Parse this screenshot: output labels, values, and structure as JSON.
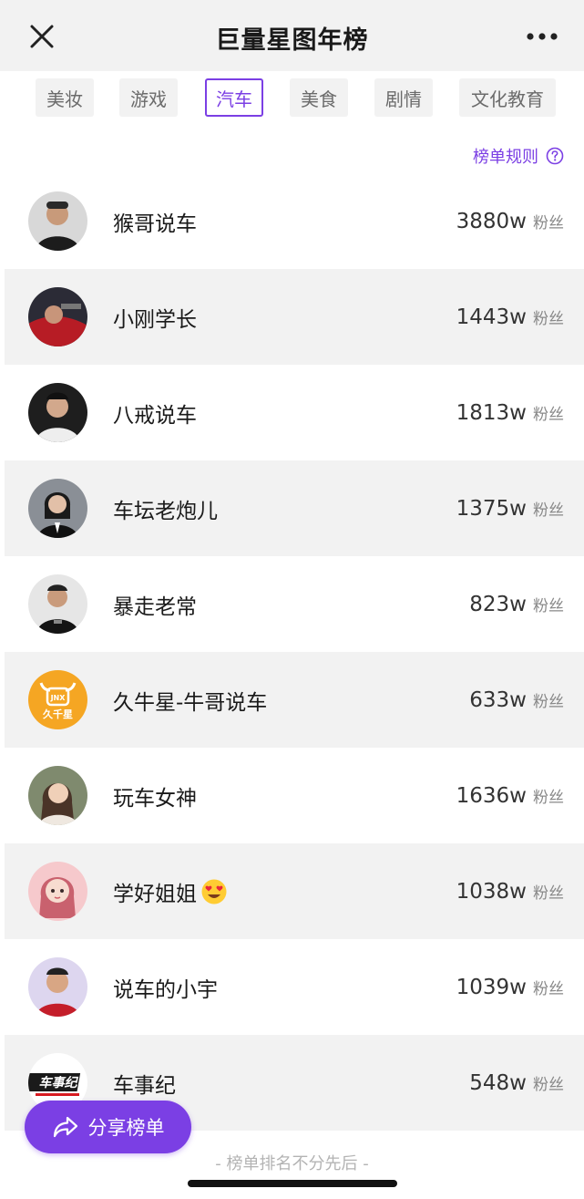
{
  "header": {
    "title": "巨量星图年榜",
    "close_icon": "close-icon",
    "more_icon": "more-icon"
  },
  "tabs": [
    {
      "label": "美妆",
      "active": false
    },
    {
      "label": "游戏",
      "active": false
    },
    {
      "label": "汽车",
      "active": true
    },
    {
      "label": "美食",
      "active": false
    },
    {
      "label": "剧情",
      "active": false
    },
    {
      "label": "文化教育",
      "active": false
    }
  ],
  "rules": {
    "label": "榜单规则",
    "icon": "question-circle-icon"
  },
  "fans_label": "粉丝",
  "items": [
    {
      "name": "猴哥说车",
      "count": "3880w"
    },
    {
      "name": "小刚学长",
      "count": "1443w"
    },
    {
      "name": "八戒说车",
      "count": "1813w"
    },
    {
      "name": "车坛老炮儿",
      "count": "1375w"
    },
    {
      "name": "暴走老常",
      "count": "823w"
    },
    {
      "name": "久牛星-牛哥说车",
      "count": "633w",
      "avatar_text": "久千星"
    },
    {
      "name": "玩车女神",
      "count": "1636w"
    },
    {
      "name": "学好姐姐",
      "count": "1038w",
      "emoji": "heart-eyes-emoji-icon"
    },
    {
      "name": "说车的小宇",
      "count": "1039w"
    },
    {
      "name": "车事纪",
      "count": "548w",
      "avatar_text": "车事纪"
    }
  ],
  "share": {
    "label": "分享榜单",
    "icon": "share-arrow-icon"
  },
  "footer_note": "- 榜单排名不分先后 -",
  "colors": {
    "accent": "#7b3fe4",
    "header_bg": "#f2f2f2",
    "alt_row_bg": "#f2f2f2"
  }
}
